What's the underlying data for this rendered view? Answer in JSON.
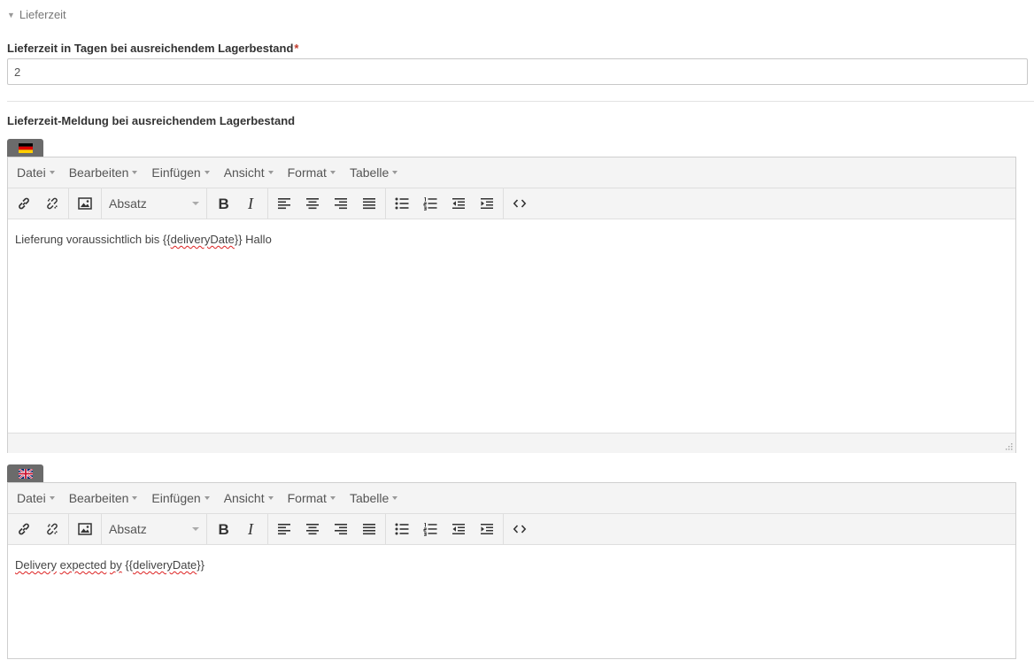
{
  "section": {
    "title": "Lieferzeit"
  },
  "delivery_days": {
    "label": "Lieferzeit in Tagen bei ausreichendem Lagerbestand",
    "required_mark": "*",
    "value": "2"
  },
  "delivery_message": {
    "label": "Lieferzeit-Meldung bei ausreichendem Lagerbestand"
  },
  "menus": {
    "file": "Datei",
    "edit": "Bearbeiten",
    "insert": "Einfügen",
    "view": "Ansicht",
    "format": "Format",
    "table": "Tabelle"
  },
  "toolbar": {
    "format_select": "Absatz"
  },
  "editor_de": {
    "language": "de",
    "text_before": "Lieferung voraussichtlich bis {{",
    "text_spell": "deliveryDate",
    "text_after": "}} Hallo"
  },
  "editor_en": {
    "language": "en",
    "word1": "Delivery",
    "word2": "expected",
    "word3": "by",
    "text_brace_open": "{{",
    "text_spell": "deliveryDate",
    "text_brace_close": "}}"
  },
  "colors": {
    "required": "#c0392b",
    "tab": "#6b6b6b",
    "toolbar_bg": "#f4f4f4"
  }
}
